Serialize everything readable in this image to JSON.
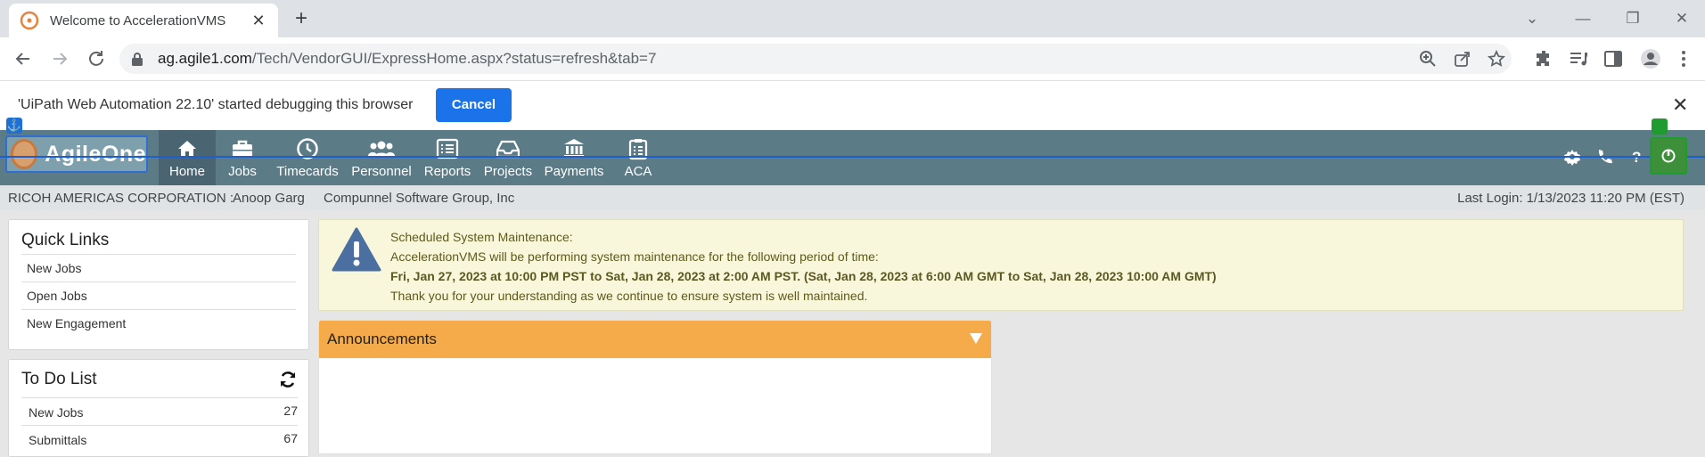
{
  "browser": {
    "tab_title": "Welcome to AccelerationVMS",
    "url_domain": "ag.agile1.com",
    "url_path": "/Tech/VendorGUI/ExpressHome.aspx?status=refresh&tab=7"
  },
  "debug_bar": {
    "message": "'UiPath Web Automation 22.10' started debugging this browser",
    "cancel_label": "Cancel"
  },
  "app": {
    "logo_text": "AgileOne",
    "nav": [
      {
        "label": "Home",
        "icon": "home-icon"
      },
      {
        "label": "Jobs",
        "icon": "briefcase-icon"
      },
      {
        "label": "Timecards",
        "icon": "clock-icon"
      },
      {
        "label": "Personnel",
        "icon": "people-icon"
      },
      {
        "label": "Reports",
        "icon": "list-icon"
      },
      {
        "label": "Projects",
        "icon": "inbox-icon"
      },
      {
        "label": "Payments",
        "icon": "bank-icon"
      },
      {
        "label": "ACA",
        "icon": "clipboard-icon"
      }
    ]
  },
  "info_bar": {
    "company": "RICOH AMERICAS CORPORATION :",
    "user": "Anoop Garg",
    "vendor": "Compunnel Software Group, Inc",
    "last_login": "Last Login: 1/13/2023 11:20 PM (EST)"
  },
  "quick_links": {
    "title": "Quick Links",
    "items": [
      "New Jobs",
      "Open Jobs",
      "New Engagement"
    ]
  },
  "todo": {
    "title": "To Do List",
    "items": [
      {
        "label": "New Jobs",
        "count": "27"
      },
      {
        "label": "Submittals",
        "count": "67"
      }
    ]
  },
  "maintenance": {
    "line1": "Scheduled System Maintenance:",
    "line2": "AccelerationVMS will be performing system maintenance for the following period of time:",
    "line3": "Fri, Jan 27, 2023 at 10:00 PM PST to Sat, Jan 28, 2023 at 2:00 AM PST. (Sat, Jan 28, 2023 at 6:00 AM GMT to Sat, Jan 28, 2023 10:00 AM GMT)",
    "line4": "Thank you for your understanding as we continue to ensure system is well maintained."
  },
  "announcements": {
    "title": "Announcements"
  },
  "colors": {
    "nav_bg": "#5b7b87",
    "alert_bg": "#f8f7dc",
    "announcement_header": "#f5ab49",
    "cancel_button": "#1a73e8"
  }
}
